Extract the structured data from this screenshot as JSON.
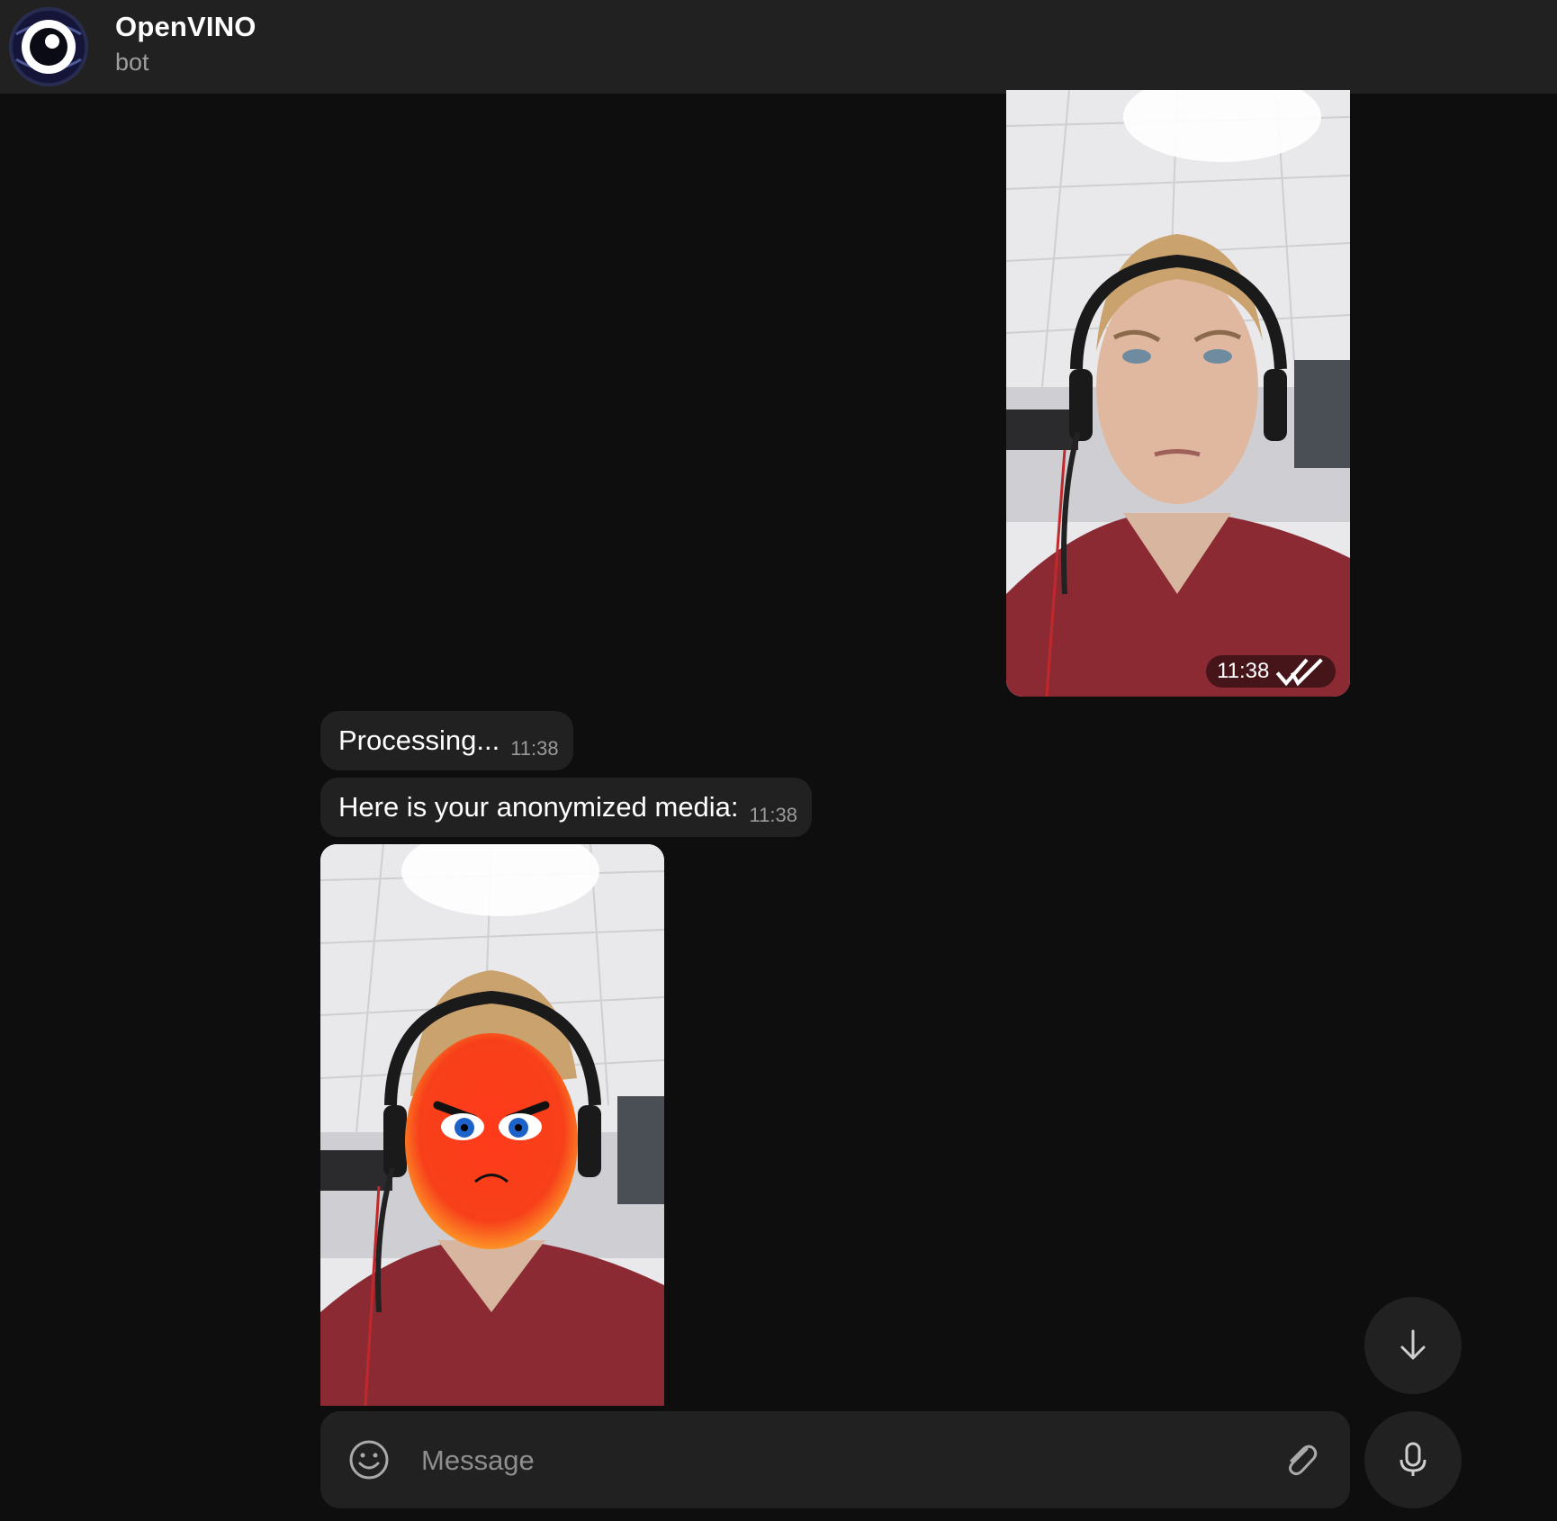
{
  "header": {
    "title": "OpenVINO",
    "subtitle": "bot",
    "avatar_icon": "eye-logo-icon"
  },
  "messages": [
    {
      "type": "photo",
      "direction": "outgoing",
      "time": "11:38",
      "status": "read",
      "status_icon": "double-check-icon"
    },
    {
      "type": "text",
      "direction": "incoming",
      "text": "Processing...",
      "time": "11:38"
    },
    {
      "type": "text",
      "direction": "incoming",
      "text": "Here is your anonymized media:",
      "time": "11:38"
    },
    {
      "type": "photo",
      "direction": "incoming",
      "overlay": "angry-face-emoji"
    }
  ],
  "composer": {
    "placeholder": "Message",
    "emoji_icon": "smiley-icon",
    "attach_icon": "paperclip-icon"
  },
  "buttons": {
    "scroll_down_icon": "arrow-down-icon",
    "voice_icon": "microphone-icon"
  },
  "colors": {
    "background": "#0e0e0e",
    "header": "#212121",
    "bubble": "#212121",
    "secondary_text": "#9e9e9e"
  }
}
